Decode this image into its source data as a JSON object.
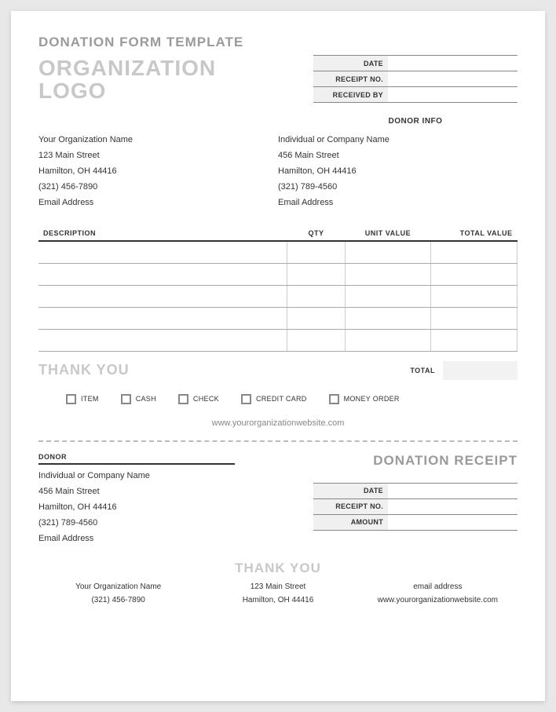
{
  "title": "DONATION FORM TEMPLATE",
  "logo_line1": "ORGANIZATION",
  "logo_line2": "LOGO",
  "meta": {
    "date_label": "DATE",
    "date_value": "",
    "receipt_no_label": "RECEIPT NO.",
    "receipt_no_value": "",
    "received_by_label": "RECEIVED BY",
    "received_by_value": ""
  },
  "donor_info_header": "DONOR INFO",
  "org": {
    "name": "Your Organization Name",
    "street": "123 Main Street",
    "city": "Hamilton, OH  44416",
    "phone": "(321) 456-7890",
    "email": "Email Address"
  },
  "donor": {
    "name": "Individual or Company Name",
    "street": "456 Main Street",
    "city": "Hamilton, OH  44416",
    "phone": "(321) 789-4560",
    "email": "Email Address"
  },
  "items_headers": {
    "description": "DESCRIPTION",
    "qty": "QTY",
    "unit_value": "UNIT VALUE",
    "total_value": "TOTAL VALUE"
  },
  "thank_you": "THANK YOU",
  "total_label": "TOTAL",
  "total_value": "",
  "payment_options": {
    "item": "ITEM",
    "cash": "CASH",
    "check": "CHECK",
    "credit_card": "CREDIT CARD",
    "money_order": "MONEY ORDER"
  },
  "website": "www.yourorganizationwebsite.com",
  "receipt": {
    "donor_label": "DONOR",
    "title": "DONATION RECEIPT",
    "date_label": "DATE",
    "date_value": "",
    "receipt_no_label": "RECEIPT NO.",
    "receipt_no_value": "",
    "amount_label": "AMOUNT",
    "amount_value": ""
  },
  "footer": {
    "org_name": "Your Organization Name",
    "org_phone": "(321) 456-7890",
    "street": "123 Main Street",
    "city": "Hamilton, OH  44416",
    "email": "email address",
    "website": "www.yourorganizationwebsite.com"
  }
}
